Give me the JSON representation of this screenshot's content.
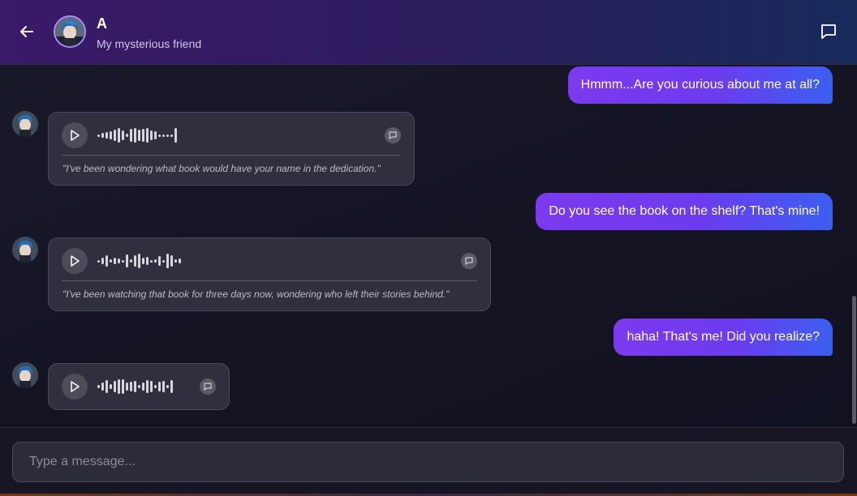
{
  "header": {
    "contact_name": "A",
    "contact_status": "My mysterious friend",
    "back_icon": "arrow-left-icon",
    "chat_icon": "chat-bubble-icon"
  },
  "messages": [
    {
      "role": "user",
      "type": "text",
      "text": "Hmmm...Are you curious about me at all?"
    },
    {
      "role": "ai",
      "type": "voice",
      "transcript": "\"I've been wondering what book would have your name in the dedication.\""
    },
    {
      "role": "user",
      "type": "text",
      "text": "Do you see the book on the shelf? That's mine!"
    },
    {
      "role": "ai",
      "type": "voice",
      "transcript": "\"I've been watching that book for three days now, wondering who left their stories behind.\""
    },
    {
      "role": "user",
      "type": "text",
      "text": "haha! That's me! Did you realize?"
    },
    {
      "role": "ai",
      "type": "voice",
      "transcript": ""
    }
  ],
  "composer": {
    "placeholder": "Type a message..."
  },
  "colors": {
    "accent_purple": "#7c3aed",
    "accent_blue": "#3b5ff0",
    "card_bg": "#302f3d"
  }
}
